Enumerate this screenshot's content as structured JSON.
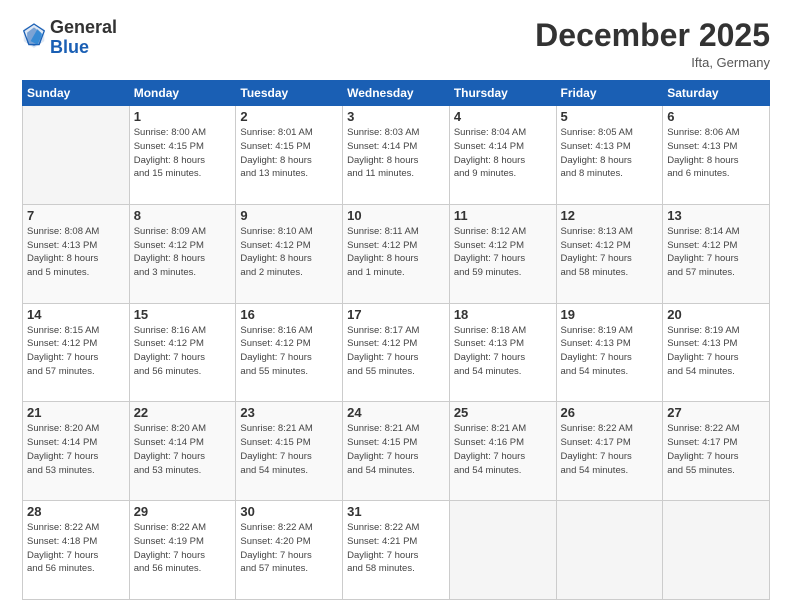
{
  "header": {
    "logo_general": "General",
    "logo_blue": "Blue",
    "month": "December 2025",
    "location": "Ifta, Germany"
  },
  "days_of_week": [
    "Sunday",
    "Monday",
    "Tuesday",
    "Wednesday",
    "Thursday",
    "Friday",
    "Saturday"
  ],
  "weeks": [
    [
      {
        "day": "",
        "info": ""
      },
      {
        "day": "1",
        "info": "Sunrise: 8:00 AM\nSunset: 4:15 PM\nDaylight: 8 hours\nand 15 minutes."
      },
      {
        "day": "2",
        "info": "Sunrise: 8:01 AM\nSunset: 4:15 PM\nDaylight: 8 hours\nand 13 minutes."
      },
      {
        "day": "3",
        "info": "Sunrise: 8:03 AM\nSunset: 4:14 PM\nDaylight: 8 hours\nand 11 minutes."
      },
      {
        "day": "4",
        "info": "Sunrise: 8:04 AM\nSunset: 4:14 PM\nDaylight: 8 hours\nand 9 minutes."
      },
      {
        "day": "5",
        "info": "Sunrise: 8:05 AM\nSunset: 4:13 PM\nDaylight: 8 hours\nand 8 minutes."
      },
      {
        "day": "6",
        "info": "Sunrise: 8:06 AM\nSunset: 4:13 PM\nDaylight: 8 hours\nand 6 minutes."
      }
    ],
    [
      {
        "day": "7",
        "info": "Sunrise: 8:08 AM\nSunset: 4:13 PM\nDaylight: 8 hours\nand 5 minutes."
      },
      {
        "day": "8",
        "info": "Sunrise: 8:09 AM\nSunset: 4:12 PM\nDaylight: 8 hours\nand 3 minutes."
      },
      {
        "day": "9",
        "info": "Sunrise: 8:10 AM\nSunset: 4:12 PM\nDaylight: 8 hours\nand 2 minutes."
      },
      {
        "day": "10",
        "info": "Sunrise: 8:11 AM\nSunset: 4:12 PM\nDaylight: 8 hours\nand 1 minute."
      },
      {
        "day": "11",
        "info": "Sunrise: 8:12 AM\nSunset: 4:12 PM\nDaylight: 7 hours\nand 59 minutes."
      },
      {
        "day": "12",
        "info": "Sunrise: 8:13 AM\nSunset: 4:12 PM\nDaylight: 7 hours\nand 58 minutes."
      },
      {
        "day": "13",
        "info": "Sunrise: 8:14 AM\nSunset: 4:12 PM\nDaylight: 7 hours\nand 57 minutes."
      }
    ],
    [
      {
        "day": "14",
        "info": "Sunrise: 8:15 AM\nSunset: 4:12 PM\nDaylight: 7 hours\nand 57 minutes."
      },
      {
        "day": "15",
        "info": "Sunrise: 8:16 AM\nSunset: 4:12 PM\nDaylight: 7 hours\nand 56 minutes."
      },
      {
        "day": "16",
        "info": "Sunrise: 8:16 AM\nSunset: 4:12 PM\nDaylight: 7 hours\nand 55 minutes."
      },
      {
        "day": "17",
        "info": "Sunrise: 8:17 AM\nSunset: 4:12 PM\nDaylight: 7 hours\nand 55 minutes."
      },
      {
        "day": "18",
        "info": "Sunrise: 8:18 AM\nSunset: 4:13 PM\nDaylight: 7 hours\nand 54 minutes."
      },
      {
        "day": "19",
        "info": "Sunrise: 8:19 AM\nSunset: 4:13 PM\nDaylight: 7 hours\nand 54 minutes."
      },
      {
        "day": "20",
        "info": "Sunrise: 8:19 AM\nSunset: 4:13 PM\nDaylight: 7 hours\nand 54 minutes."
      }
    ],
    [
      {
        "day": "21",
        "info": "Sunrise: 8:20 AM\nSunset: 4:14 PM\nDaylight: 7 hours\nand 53 minutes."
      },
      {
        "day": "22",
        "info": "Sunrise: 8:20 AM\nSunset: 4:14 PM\nDaylight: 7 hours\nand 53 minutes."
      },
      {
        "day": "23",
        "info": "Sunrise: 8:21 AM\nSunset: 4:15 PM\nDaylight: 7 hours\nand 54 minutes."
      },
      {
        "day": "24",
        "info": "Sunrise: 8:21 AM\nSunset: 4:15 PM\nDaylight: 7 hours\nand 54 minutes."
      },
      {
        "day": "25",
        "info": "Sunrise: 8:21 AM\nSunset: 4:16 PM\nDaylight: 7 hours\nand 54 minutes."
      },
      {
        "day": "26",
        "info": "Sunrise: 8:22 AM\nSunset: 4:17 PM\nDaylight: 7 hours\nand 54 minutes."
      },
      {
        "day": "27",
        "info": "Sunrise: 8:22 AM\nSunset: 4:17 PM\nDaylight: 7 hours\nand 55 minutes."
      }
    ],
    [
      {
        "day": "28",
        "info": "Sunrise: 8:22 AM\nSunset: 4:18 PM\nDaylight: 7 hours\nand 56 minutes."
      },
      {
        "day": "29",
        "info": "Sunrise: 8:22 AM\nSunset: 4:19 PM\nDaylight: 7 hours\nand 56 minutes."
      },
      {
        "day": "30",
        "info": "Sunrise: 8:22 AM\nSunset: 4:20 PM\nDaylight: 7 hours\nand 57 minutes."
      },
      {
        "day": "31",
        "info": "Sunrise: 8:22 AM\nSunset: 4:21 PM\nDaylight: 7 hours\nand 58 minutes."
      },
      {
        "day": "",
        "info": ""
      },
      {
        "day": "",
        "info": ""
      },
      {
        "day": "",
        "info": ""
      }
    ]
  ]
}
